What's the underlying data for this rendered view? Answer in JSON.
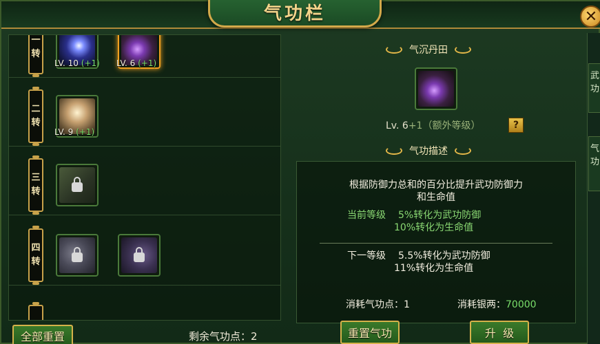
{
  "window": {
    "title": "气功栏",
    "close_glyph": "✕"
  },
  "tiers": [
    {
      "line1": "一",
      "line2": "转",
      "slots": [
        {
          "art": "art-blue",
          "level": "LV. 10",
          "bonus": "(+1)",
          "locked": false,
          "selected": false
        },
        {
          "art": "art-purple",
          "level": "LV. 6",
          "bonus": "(+1)",
          "locked": false,
          "selected": true
        }
      ]
    },
    {
      "line1": "二",
      "line2": "转",
      "slots": [
        {
          "art": "art-tan",
          "level": "LV. 9",
          "bonus": "(+1)",
          "locked": false,
          "selected": false
        }
      ]
    },
    {
      "line1": "三",
      "line2": "转",
      "slots": [
        {
          "art": "art-locked-green",
          "locked": true,
          "selected": false
        }
      ]
    },
    {
      "line1": "四",
      "line2": "转",
      "slots": [
        {
          "art": "art-locked-grey",
          "locked": true,
          "selected": false
        },
        {
          "art": "art-locked-violet",
          "locked": true,
          "selected": false
        }
      ]
    }
  ],
  "left_footer": {
    "reset_all_label": "全部重置",
    "remaining_label": "剩余气功点：2"
  },
  "detail": {
    "skill_name": "气沉丹田",
    "level_prefix": "Lv. 6",
    "level_bonus": "+1（额外等级）",
    "help_glyph": "?",
    "desc_header": "气功描述",
    "desc_line1": "根据防御力总和的百分比提升武功防御力",
    "desc_line2": "和生命值",
    "current_label": "当前等级",
    "current_effect1": "5%转化为武功防御",
    "current_effect2": "10%转化为生命值",
    "next_label": "下一等级",
    "next_effect1": "5.5%转化为武功防御",
    "next_effect2": "11%转化为生命值",
    "cost_points": "消耗气功点：1",
    "cost_silver_label": "消耗银两：",
    "cost_silver_value": "70000",
    "reset_label": "重置气功",
    "upgrade_label": "升  级"
  },
  "side_tabs": [
    {
      "text": "武\n功"
    },
    {
      "text": "气\n功"
    }
  ],
  "colors": {
    "accent_gold": "#d6b24a",
    "bonus_green": "#7adf6a",
    "panel_green": "#1d3a22"
  }
}
